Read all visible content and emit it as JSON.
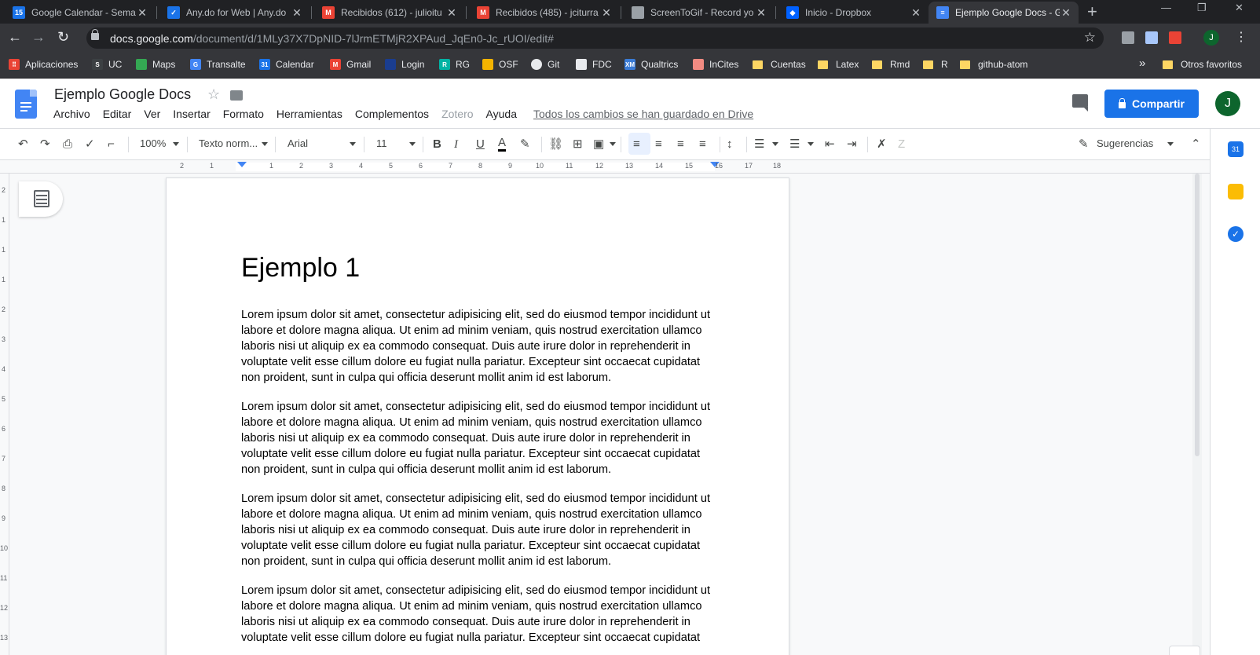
{
  "browser": {
    "tabs": [
      {
        "title": "Google Calendar - Sema",
        "favicon": "calendar-favicon",
        "color": "#1a73e8"
      },
      {
        "title": "Any.do for Web | Any.do",
        "favicon": "anydo-favicon",
        "color": "#1a73e8"
      },
      {
        "title": "Recibidos (612) - julioitu",
        "favicon": "gmail-favicon",
        "color": "#ea4335"
      },
      {
        "title": "Recibidos (485) - jciturra",
        "favicon": "gmail-favicon",
        "color": "#ea4335"
      },
      {
        "title": "ScreenToGif - Record yo",
        "favicon": "screentogif-favicon",
        "color": "#9aa0a6"
      },
      {
        "title": "Inicio - Dropbox",
        "favicon": "dropbox-favicon",
        "color": "#0061ff"
      },
      {
        "title": "Ejemplo Google Docs - G",
        "favicon": "docs-favicon",
        "color": "#4285f4",
        "active": true
      }
    ],
    "tab_close_glyph": "✕",
    "new_tab_glyph": "+",
    "url_host": "docs.google.com",
    "url_path": "/document/d/1MLy37X7DpNID-7lJrmETMjR2XPAud_JqEn0-Jc_rUOI/edit#",
    "profile_initial": "J",
    "bookmarks": [
      {
        "label": "Aplicaciones",
        "icon": "apps-grid-icon"
      },
      {
        "label": "UC",
        "icon": "uc-icon"
      },
      {
        "label": "Maps",
        "icon": "maps-icon"
      },
      {
        "label": "Transalte",
        "icon": "translate-icon"
      },
      {
        "label": "Calendar",
        "icon": "calendar-icon"
      },
      {
        "label": "Gmail",
        "icon": "gmail-icon"
      },
      {
        "label": "Login",
        "icon": "login-icon"
      },
      {
        "label": "RG",
        "icon": "researchgate-icon"
      },
      {
        "label": "OSF",
        "icon": "osf-icon"
      },
      {
        "label": "Git",
        "icon": "github-icon"
      },
      {
        "label": "FDC",
        "icon": "fdc-icon"
      },
      {
        "label": "Qualtrics",
        "icon": "qualtrics-icon"
      },
      {
        "label": "InCites",
        "icon": "incites-icon"
      },
      {
        "label": "Cuentas",
        "icon": "folder-icon"
      },
      {
        "label": "Latex",
        "icon": "folder-icon"
      },
      {
        "label": "Rmd",
        "icon": "folder-icon"
      },
      {
        "label": "R",
        "icon": "folder-icon"
      },
      {
        "label": "github-atom",
        "icon": "folder-icon"
      }
    ],
    "overflow_glyph": "»",
    "other_bookmarks": "Otros favoritos"
  },
  "docs": {
    "title": "Ejemplo Google Docs",
    "menu": [
      {
        "label": "Archivo"
      },
      {
        "label": "Editar"
      },
      {
        "label": "Ver"
      },
      {
        "label": "Insertar"
      },
      {
        "label": "Formato"
      },
      {
        "label": "Herramientas"
      },
      {
        "label": "Complementos"
      },
      {
        "label": "Zotero",
        "dim": true
      },
      {
        "label": "Ayuda"
      }
    ],
    "saved_status": "Todos los cambios se han guardado en Drive",
    "share_label": "Compartir",
    "user_initial": "J",
    "toolbar": {
      "zoom": "100%",
      "style": "Texto norm...",
      "font": "Arial",
      "size": "11",
      "bold": "B",
      "italic": "I",
      "underline": "U",
      "text_color_glyph": "A",
      "mode": "Sugerencias"
    },
    "ruler_numbers": [
      "2",
      "1",
      "1",
      "2",
      "3",
      "4",
      "5",
      "6",
      "7",
      "8",
      "9",
      "10",
      "11",
      "12",
      "13",
      "14",
      "15",
      "16",
      "17",
      "18"
    ],
    "vruler_numbers": [
      "2",
      "1",
      "1",
      "1",
      "2",
      "3",
      "4",
      "5",
      "6",
      "7",
      "8",
      "9",
      "10",
      "11",
      "12",
      "13"
    ],
    "heading": "Ejemplo 1",
    "paragraphs": [
      "Lorem ipsum dolor sit amet, consectetur adipisicing elit, sed do eiusmod tempor incididunt ut labore et dolore magna aliqua. Ut enim ad minim veniam, quis nostrud exercitation ullamco laboris nisi ut aliquip ex ea commodo consequat. Duis aute irure dolor in reprehenderit in voluptate velit esse cillum dolore eu fugiat nulla pariatur. Excepteur sint occaecat cupidatat non proident, sunt in culpa qui officia deserunt mollit anim id est laborum.",
      "Lorem ipsum dolor sit amet, consectetur adipisicing elit, sed do eiusmod tempor incididunt ut labore et dolore magna aliqua. Ut enim ad minim veniam, quis nostrud exercitation ullamco laboris nisi ut aliquip ex ea commodo consequat. Duis aute irure dolor in reprehenderit in voluptate velit esse cillum dolore eu fugiat nulla pariatur. Excepteur sint occaecat cupidatat non proident, sunt in culpa qui officia deserunt mollit anim id est laborum.",
      "Lorem ipsum dolor sit amet, consectetur adipisicing elit, sed do eiusmod tempor incididunt ut labore et dolore magna aliqua. Ut enim ad minim veniam, quis nostrud exercitation ullamco laboris nisi ut aliquip ex ea commodo consequat. Duis aute irure dolor in reprehenderit in voluptate velit esse cillum dolore eu fugiat nulla pariatur. Excepteur sint occaecat cupidatat non proident, sunt in culpa qui officia deserunt mollit anim id est laborum.",
      "Lorem ipsum dolor sit amet, consectetur adipisicing elit, sed do eiusmod tempor incididunt ut labore et dolore magna aliqua. Ut enim ad minim veniam, quis nostrud exercitation ullamco laboris nisi ut aliquip ex ea commodo consequat. Duis aute irure dolor in reprehenderit in voluptate velit esse cillum dolore eu fugiat nulla pariatur. Excepteur sint occaecat cupidatat"
    ]
  },
  "colors": {
    "accent": "#1a73e8",
    "brand_docs": "#4285f4",
    "avatar": "#0d652d"
  }
}
